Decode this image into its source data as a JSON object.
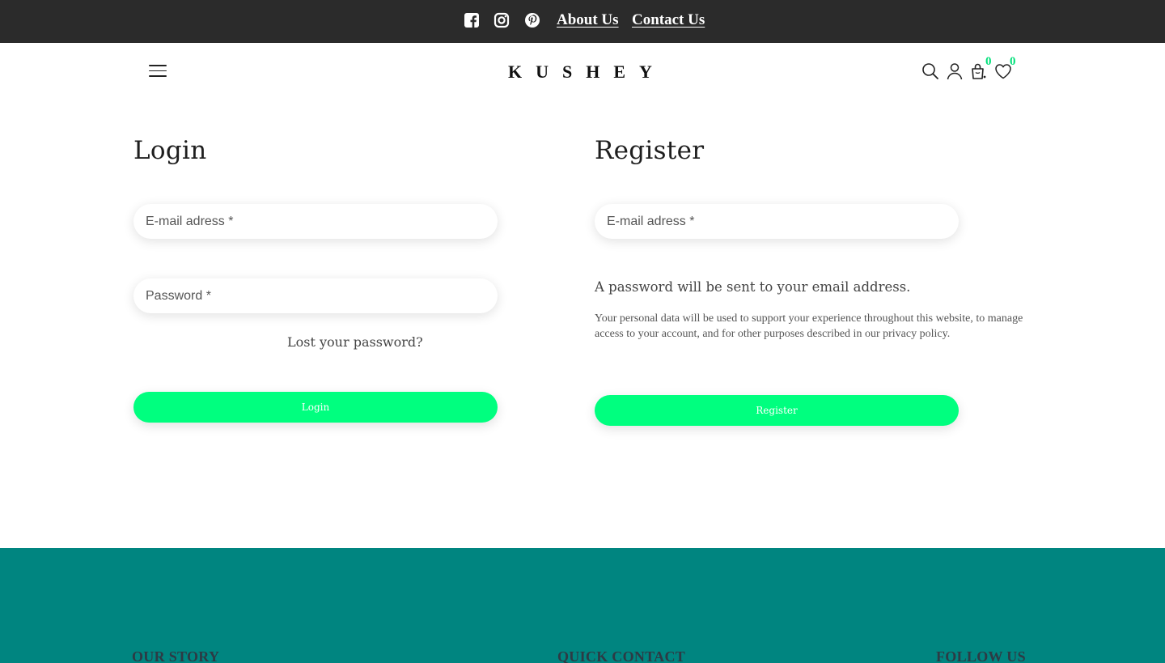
{
  "topbar": {
    "icons": [
      "facebook-square-icon",
      "instagram-icon",
      "pinterest-icon"
    ],
    "links": [
      "About Us",
      "Contact Us"
    ]
  },
  "header": {
    "logo": "KUSHEY",
    "icons": [
      "menu-icon",
      "search-icon",
      "user-icon",
      "cart-icon",
      "heart-icon"
    ],
    "cart_count": "0",
    "wishlist_count": "0"
  },
  "login": {
    "title": "Login",
    "email_placeholder": "E-mail adress *",
    "password_placeholder": "Password *",
    "lost_password": "Lost your password?",
    "button": "Login"
  },
  "register": {
    "title": "Register",
    "email_placeholder": "E-mail adress *",
    "password_note": "A password will be sent to your email address.",
    "privacy_text": "Your personal data will be used to support your experience throughout this website, to manage access to your account, and for other purposes described in our ",
    "privacy_link": "privacy policy",
    "privacy_end": ".",
    "button": "Register"
  },
  "footer": {
    "headings": [
      "OUR STORY",
      "QUICK CONTACT",
      "FOLLOW US"
    ]
  },
  "colors": {
    "topbar": "#2b2b2b",
    "accent": "#00ff7f",
    "badge": "#00e07a",
    "footer": "#008580"
  }
}
